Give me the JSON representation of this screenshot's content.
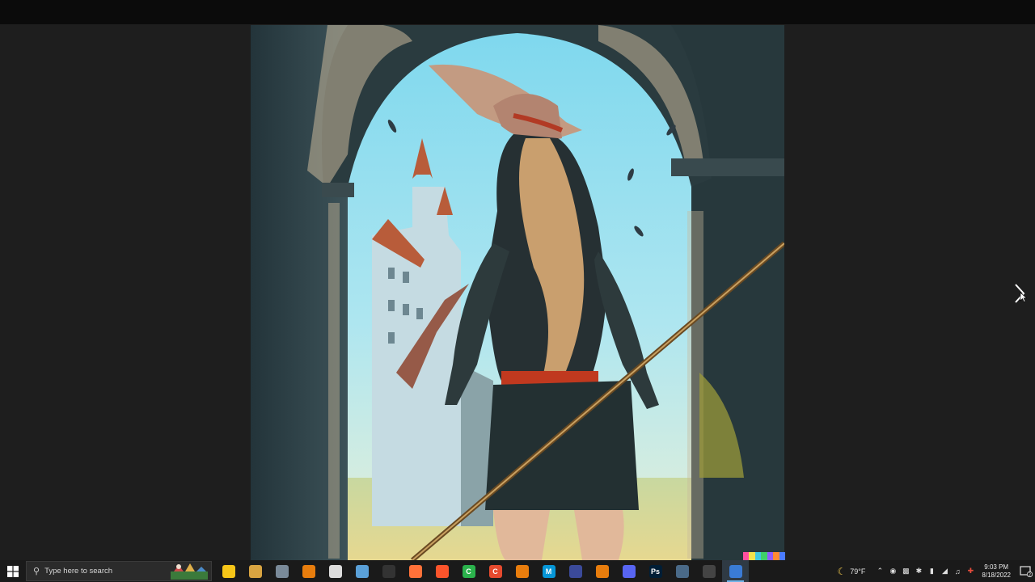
{
  "viewer": {
    "image_subject": "illustration"
  },
  "taskbar": {
    "search_placeholder": "Type here to search",
    "apps": [
      {
        "name": "file-explorer",
        "label": "",
        "color": "#f5c518"
      },
      {
        "name": "notes",
        "label": "",
        "color": "#d9a441"
      },
      {
        "name": "app-bird",
        "label": "",
        "color": "#7a8a99"
      },
      {
        "name": "blender",
        "label": "",
        "color": "#e87d0d"
      },
      {
        "name": "inkscape",
        "label": "",
        "color": "#dddddd"
      },
      {
        "name": "cube-app",
        "label": "",
        "color": "#5aa0d8"
      },
      {
        "name": "unity",
        "label": "",
        "color": "#333333"
      },
      {
        "name": "firefox",
        "label": "",
        "color": "#ff7139"
      },
      {
        "name": "brave",
        "label": "",
        "color": "#fb542b"
      },
      {
        "name": "camtasia",
        "label": "C",
        "color": "#2bb24c"
      },
      {
        "name": "camtasia-red",
        "label": "C",
        "color": "#e64a2e"
      },
      {
        "name": "blender-2",
        "label": "",
        "color": "#e87d0d"
      },
      {
        "name": "maya",
        "label": "M",
        "color": "#0696d7"
      },
      {
        "name": "ship-app",
        "label": "",
        "color": "#3b4a9a"
      },
      {
        "name": "blender-3",
        "label": "",
        "color": "#e87d0d"
      },
      {
        "name": "discord",
        "label": "",
        "color": "#5865f2"
      },
      {
        "name": "photoshop",
        "label": "Ps",
        "color": "#001e36"
      },
      {
        "name": "gallery",
        "label": "",
        "color": "#4a6a88"
      },
      {
        "name": "obs",
        "label": "",
        "color": "#444444"
      },
      {
        "name": "photos",
        "label": "",
        "color": "#3a7bd5"
      }
    ],
    "weather": "79°F",
    "time": "9:03 PM",
    "date": "8/18/2022",
    "notification_count": "2"
  }
}
